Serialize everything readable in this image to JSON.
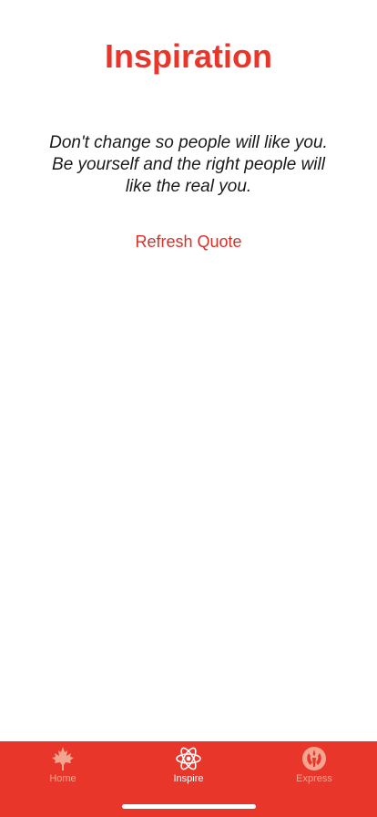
{
  "header": {
    "title": "Inspiration"
  },
  "quote": {
    "lines": [
      "Don't change so people will like you.",
      "Be yourself and the right people will",
      "like the real you."
    ]
  },
  "actions": {
    "refresh_label": "Refresh Quote"
  },
  "tabbar": {
    "tabs": [
      {
        "label": "Home",
        "icon": "maple-leaf-icon",
        "active": false
      },
      {
        "label": "Inspire",
        "icon": "atom-icon",
        "active": true
      },
      {
        "label": "Express",
        "icon": "rebel-alliance-icon",
        "active": false
      }
    ]
  },
  "colors": {
    "accent": "#e8362b",
    "tab_inactive": "#f4a58f",
    "tab_active": "#ffffff",
    "quote_text": "#1a1a1a"
  }
}
